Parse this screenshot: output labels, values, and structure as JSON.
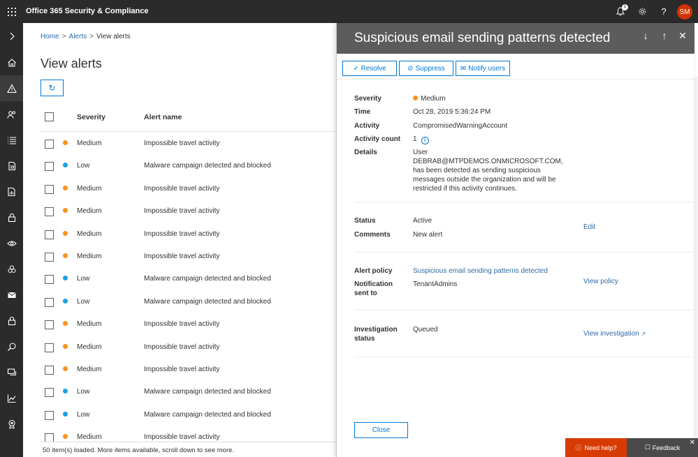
{
  "topbar": {
    "app_title": "Office 365 Security & Compliance",
    "notification_count": "1",
    "help_icon": "?",
    "avatar_initials": "SM"
  },
  "rail": {
    "expand_icon": "chevron-right-icon",
    "icons": [
      "home-icon",
      "alert-icon",
      "people-icon",
      "list-icon",
      "document-icon",
      "report-icon",
      "lock-icon",
      "eye-icon",
      "biohazard-icon",
      "mail-icon",
      "lock-icon",
      "search-icon",
      "chat-icon",
      "chart-icon",
      "badge-icon"
    ]
  },
  "breadcrumb": {
    "home": "Home",
    "alerts": "Alerts",
    "current": "View alerts",
    "sep1": ">",
    "sep2": ">"
  },
  "main": {
    "title": "View alerts",
    "refresh_glyph": "↻",
    "columns": {
      "severity": "Severity",
      "alert_name": "Alert name"
    },
    "rows": [
      {
        "severity": "Medium",
        "name": "Impossible travel activity"
      },
      {
        "severity": "Low",
        "name": "Malware campaign detected and blocked"
      },
      {
        "severity": "Medium",
        "name": "Impossible travel activity"
      },
      {
        "severity": "Medium",
        "name": "Impossible travel activity"
      },
      {
        "severity": "Medium",
        "name": "Impossible travel activity"
      },
      {
        "severity": "Medium",
        "name": "Impossible travel activity"
      },
      {
        "severity": "Low",
        "name": "Malware campaign detected and blocked"
      },
      {
        "severity": "Low",
        "name": "Malware campaign detected and blocked"
      },
      {
        "severity": "Medium",
        "name": "Impossible travel activity"
      },
      {
        "severity": "Medium",
        "name": "Impossible travel activity"
      },
      {
        "severity": "Medium",
        "name": "Impossible travel activity"
      },
      {
        "severity": "Low",
        "name": "Malware campaign detected and blocked"
      },
      {
        "severity": "Low",
        "name": "Malware campaign detected and blocked"
      },
      {
        "severity": "Medium",
        "name": "Impossible travel activity"
      }
    ],
    "status_text": "50 item(s) loaded. More items available, scroll down to see more."
  },
  "colors": {
    "medium": "#f7931e",
    "low": "#1ba1e2",
    "accent": "#0078d4",
    "link": "#2f6aa6",
    "help": "#d83b01"
  },
  "panel": {
    "title": "Suspicious email sending patterns detected",
    "nav_down": "↓",
    "nav_up": "↑",
    "close": "✕",
    "actions": {
      "resolve": "Resolve",
      "suppress": "Suppress",
      "notify": "Notify users"
    },
    "fields": {
      "severity_label": "Severity",
      "severity_value": "Medium",
      "time_label": "Time",
      "time_value": "Oct 28, 2019 5:36:24 PM",
      "activity_label": "Activity",
      "activity_value": "CompromisedWarningAccount",
      "activity_count_label": "Activity count",
      "activity_count_value": "1",
      "details_label": "Details",
      "details_value": "User DEBRAB@MTPDEMOS.ONMICROSOFT.COM, has been detected as sending suspicious messages outside the organization and will be restricted if this activity continues.",
      "status_label": "Status",
      "status_value": "Active",
      "comments_label": "Comments",
      "comments_value": "New alert",
      "edit_link": "Edit",
      "policy_label": "Alert policy",
      "policy_value": "Suspicious email sending patterns detected",
      "notification_label_1": "Notification",
      "notification_label_2": "sent to",
      "notification_value": "TenantAdmins",
      "view_policy_link": "View policy",
      "investigation_label_1": "Investigation",
      "investigation_label_2": "status",
      "investigation_value": "Queued",
      "view_investigation_link": "View investigation"
    },
    "close_button": "Close"
  },
  "help": {
    "need_help": "Need help?",
    "feedback": "Feedback",
    "close": "✕"
  }
}
